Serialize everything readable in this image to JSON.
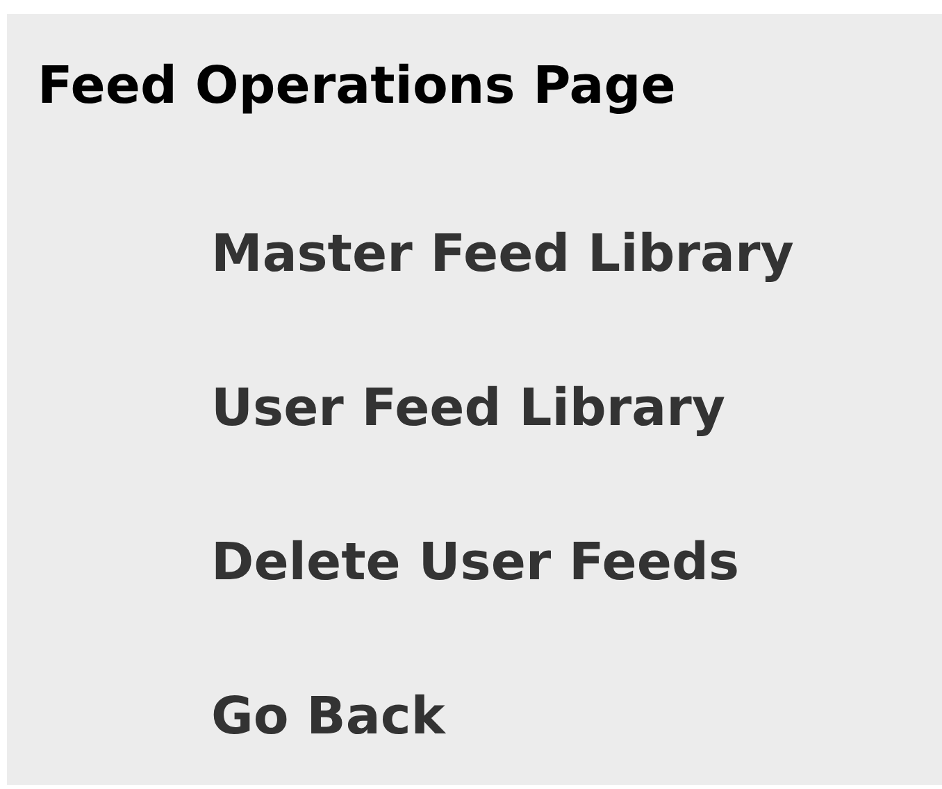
{
  "page": {
    "title": "Feed Operations Page"
  },
  "menu": [
    {
      "label": "Master Feed Library"
    },
    {
      "label": "User Feed Library"
    },
    {
      "label": "Delete User Feeds"
    },
    {
      "label": "Go Back"
    }
  ]
}
